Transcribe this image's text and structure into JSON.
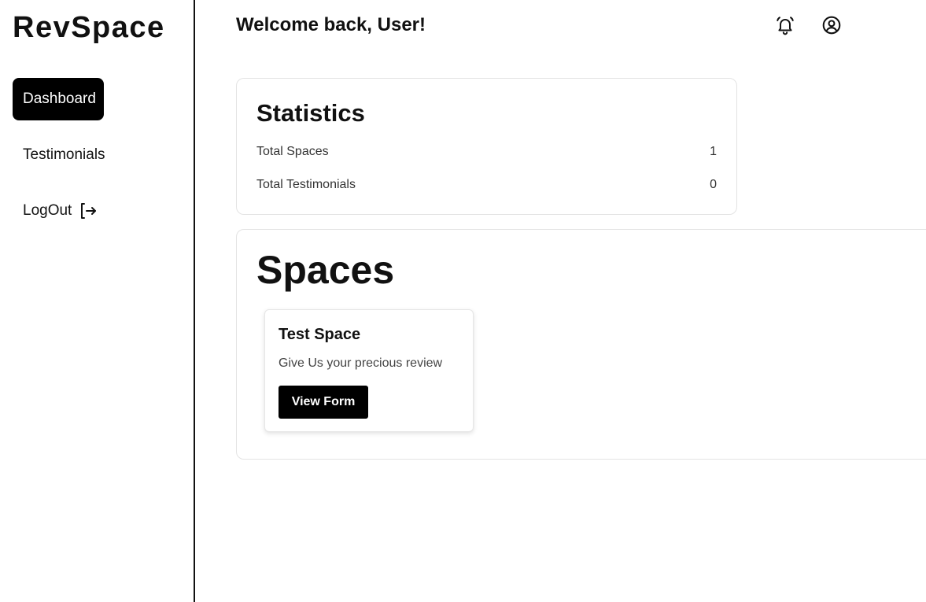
{
  "sidebar": {
    "brand": "RevSpace",
    "items": [
      {
        "label": "Dashboard",
        "active": true
      },
      {
        "label": "Testimonials",
        "active": false
      },
      {
        "label": "LogOut",
        "active": false,
        "icon": "logout-icon"
      }
    ]
  },
  "header": {
    "welcome": "Welcome back, User!",
    "icons": [
      "bell-icon",
      "user-circle-icon"
    ]
  },
  "statistics": {
    "title": "Statistics",
    "rows": [
      {
        "label": "Total Spaces",
        "value": "1"
      },
      {
        "label": "Total Testimonials",
        "value": "0"
      }
    ]
  },
  "spaces": {
    "title": "Spaces",
    "cards": [
      {
        "name": "Test Space",
        "description": "Give Us your precious review",
        "button_label": "View Form"
      }
    ]
  },
  "colors": {
    "accent": "#000000",
    "text": "#111111",
    "border": "#e3e3e3"
  }
}
